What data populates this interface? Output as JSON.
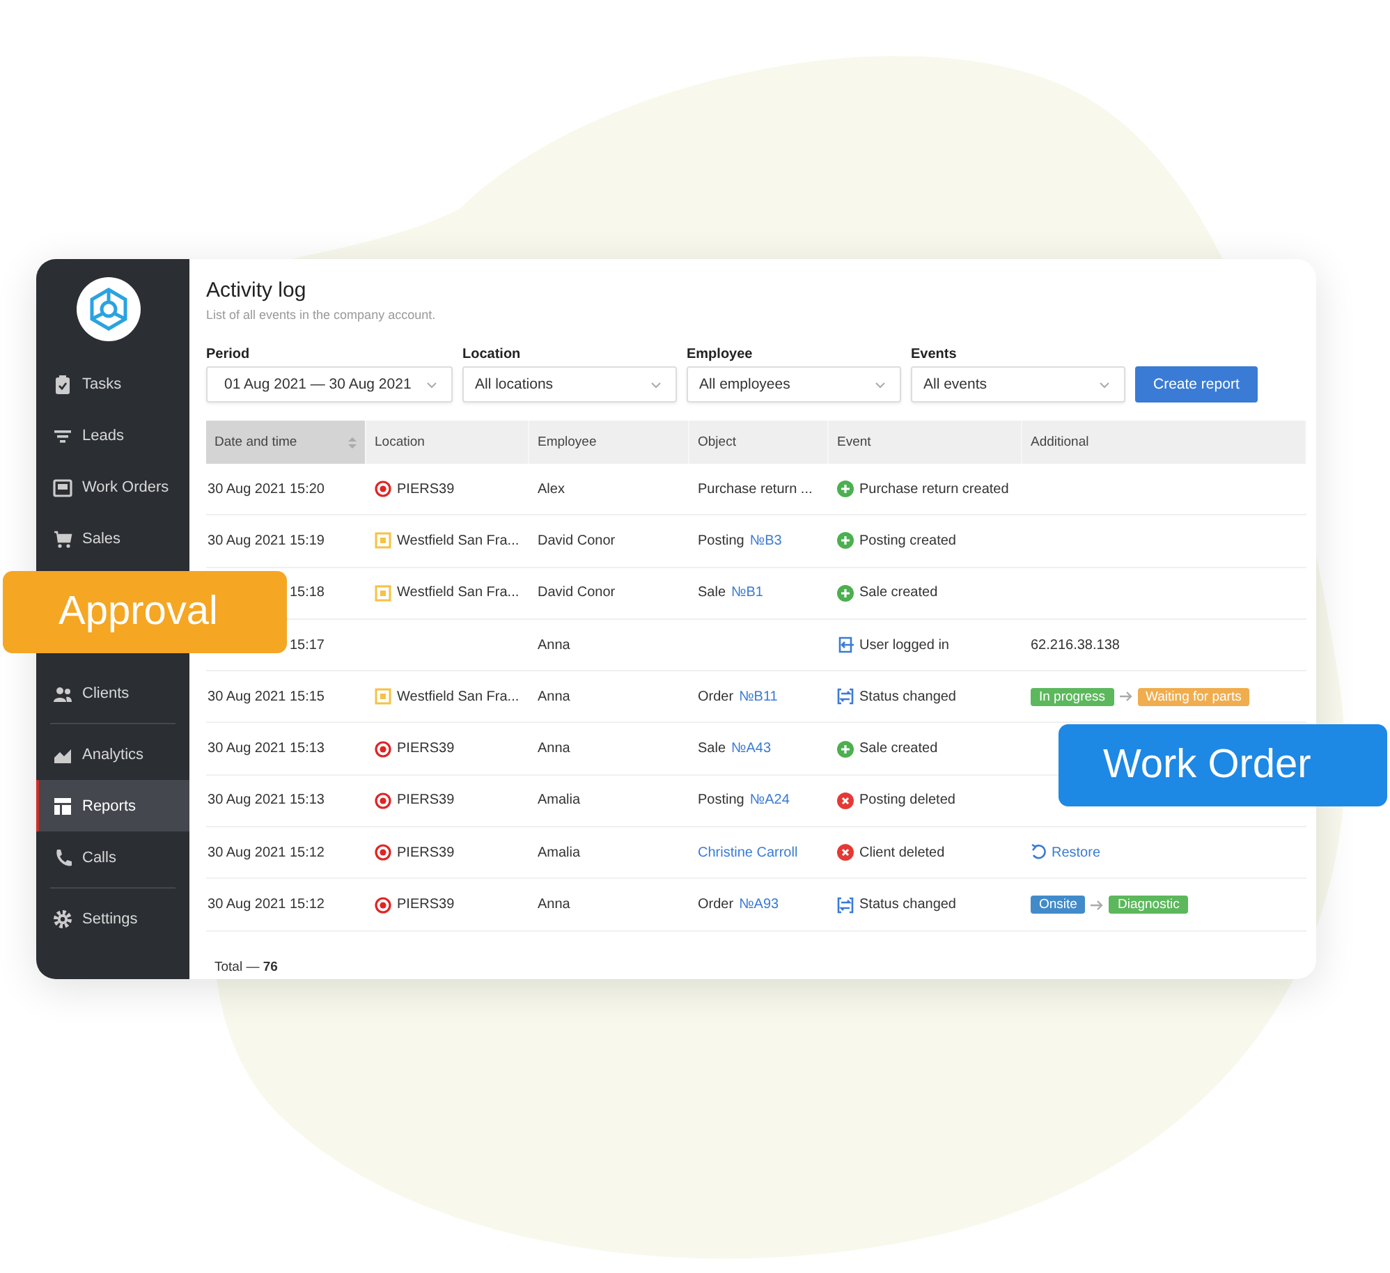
{
  "sidebar": {
    "groups": [
      [
        {
          "label": "Tasks",
          "selected": false
        },
        {
          "label": "Leads",
          "selected": false
        },
        {
          "label": "Work Orders",
          "selected": false
        },
        {
          "label": "Sales",
          "selected": false
        }
      ],
      [
        {
          "label": "Clients",
          "selected": false
        }
      ],
      [
        {
          "label": "Analytics",
          "selected": false
        },
        {
          "label": "Reports",
          "selected": true
        },
        {
          "label": "Calls",
          "selected": false
        }
      ],
      [
        {
          "label": "Settings",
          "selected": false
        }
      ]
    ]
  },
  "page": {
    "title": "Activity log",
    "subtitle": "List of all events in the company account."
  },
  "filters": [
    {
      "label": "Period",
      "value": "01 Aug 2021 — 30 Aug 2021"
    },
    {
      "label": "Location",
      "value": "All locations"
    },
    {
      "label": "Employee",
      "value": "All employees"
    },
    {
      "label": "Events",
      "value": "All events"
    }
  ],
  "create_button": "Create report",
  "table": {
    "columns": [
      {
        "label": "Date and time",
        "sorted": true
      },
      {
        "label": "Location",
        "sorted": false
      },
      {
        "label": "Employee",
        "sorted": false
      },
      {
        "label": "Object",
        "sorted": false
      },
      {
        "label": "Event",
        "sorted": false
      },
      {
        "label": "Additional",
        "sorted": false
      }
    ],
    "rows": [
      {
        "date": "30 Aug 2021 15:20",
        "location": {
          "kind": "target",
          "name": "PIERS39"
        },
        "employee": "Alex",
        "object": {
          "text": "Purchase return ..."
        },
        "event": {
          "kind": "created",
          "text": "Purchase return created"
        }
      },
      {
        "date": "30 Aug 2021 15:19",
        "location": {
          "kind": "store",
          "name": "Westfield San Fra..."
        },
        "employee": "David Conor",
        "object": {
          "text": "Posting",
          "link": "№B3"
        },
        "event": {
          "kind": "created",
          "text": "Posting created"
        }
      },
      {
        "date": "15:18",
        "location": {
          "kind": "store",
          "name": "Westfield San Fra..."
        },
        "employee": "David Conor",
        "object": {
          "text": "Sale",
          "link": "№B1"
        },
        "event": {
          "kind": "created",
          "text": "Sale created"
        }
      },
      {
        "date": "15:17",
        "employee": "Anna",
        "event": {
          "kind": "login",
          "text": "User logged in"
        },
        "additional": {
          "kind": "text",
          "text": "62.216.38.138"
        }
      },
      {
        "date": "30 Aug 2021 15:15",
        "location": {
          "kind": "store",
          "name": "Westfield San Fra..."
        },
        "employee": "Anna",
        "object": {
          "text": "Order",
          "link": "№B11"
        },
        "event": {
          "kind": "status",
          "text": "Status changed"
        },
        "additional": {
          "kind": "statuses",
          "from": {
            "label": "In progress",
            "color": "#5cb85c"
          },
          "to": {
            "label": "Waiting for parts",
            "color": "#f0ad4e"
          }
        }
      },
      {
        "date": "30 Aug 2021 15:13",
        "location": {
          "kind": "target",
          "name": "PIERS39"
        },
        "employee": "Anna",
        "object": {
          "text": "Sale",
          "link": "№A43"
        },
        "event": {
          "kind": "created",
          "text": "Sale created"
        }
      },
      {
        "date": "30 Aug 2021 15:13",
        "location": {
          "kind": "target",
          "name": "PIERS39"
        },
        "employee": "Amalia",
        "object": {
          "text": "Posting",
          "link": "№A24"
        },
        "event": {
          "kind": "deleted",
          "text": "Posting deleted"
        }
      },
      {
        "date": "30 Aug 2021 15:12",
        "location": {
          "kind": "target",
          "name": "PIERS39"
        },
        "employee": "Amalia",
        "object": {
          "link": "Christine Carroll"
        },
        "event": {
          "kind": "deleted",
          "text": "Client deleted"
        },
        "additional": {
          "kind": "restore",
          "text": "Restore"
        }
      },
      {
        "date": "30 Aug 2021 15:12",
        "location": {
          "kind": "target",
          "name": "PIERS39"
        },
        "employee": "Anna",
        "object": {
          "text": "Order",
          "link": "№A93"
        },
        "event": {
          "kind": "status",
          "text": "Status changed"
        },
        "additional": {
          "kind": "statuses",
          "from": {
            "label": "Onsite",
            "color": "#428bca"
          },
          "to": {
            "label": "Diagnostic",
            "color": "#5cb85c"
          }
        }
      }
    ],
    "total": {
      "text": "Total —",
      "count": "76"
    }
  },
  "callouts": [
    {
      "kind": "orange",
      "text": "Approval"
    },
    {
      "kind": "blue",
      "text": "Work Order"
    }
  ]
}
